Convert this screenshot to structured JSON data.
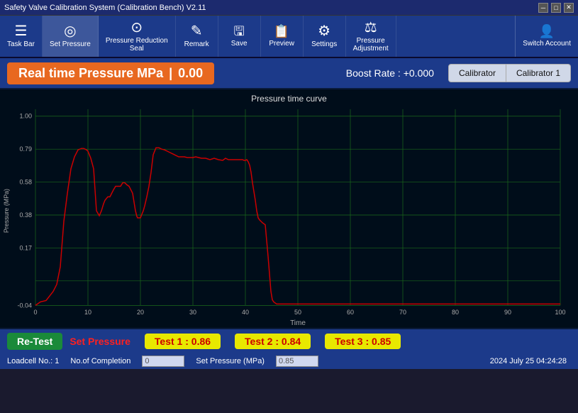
{
  "window": {
    "title": "Safety Valve Calibration System (Calibration Bench) V2.11",
    "minimize": "─",
    "maximize": "□",
    "close": "✕"
  },
  "toolbar": {
    "items": [
      {
        "id": "task-bar",
        "icon": "☰",
        "label": "Task Bar"
      },
      {
        "id": "set-pressure",
        "icon": "◎",
        "label": "Set Pressure"
      },
      {
        "id": "pressure-reduction-seal",
        "icon": "⊙",
        "label": "Pressure Reduction\nSeal"
      },
      {
        "id": "remark",
        "icon": "✎",
        "label": "Remark"
      },
      {
        "id": "save",
        "icon": "💾",
        "label": "Save"
      },
      {
        "id": "preview",
        "icon": "📋",
        "label": "Preview"
      },
      {
        "id": "settings",
        "icon": "⚙",
        "label": "Settings"
      },
      {
        "id": "pressure-adjustment",
        "icon": "⚖",
        "label": "Pressure\nAdjustment"
      }
    ],
    "switch_account_label": "Switch Account",
    "switch_account_icon": "👤"
  },
  "pressure": {
    "label": "Real time Pressure MPa",
    "separator": "|",
    "value": "0.00",
    "boost_rate_label": "Boost Rate :",
    "boost_rate_value": "+0.000",
    "calibrator_label": "Calibrator",
    "calibrator1_label": "Calibrator 1"
  },
  "chart": {
    "title": "Pressure time curve",
    "y_axis_label": "Pressure (MPa)",
    "x_axis_label": "Time",
    "y_ticks": [
      "1.00",
      "0.79",
      "0.58",
      "0.38",
      "0.17",
      "-0.04"
    ],
    "x_ticks": [
      "0",
      "10",
      "20",
      "30",
      "40",
      "50",
      "60",
      "70",
      "80",
      "90",
      "100"
    ],
    "bg_color": "#000d1a",
    "grid_color": "#1a5a1a",
    "line_color": "#cc0000"
  },
  "bottom": {
    "retest_label": "Re-Test",
    "set_pressure_label": "Set Pressure",
    "test1_label": "Test 1 : 0.86",
    "test2_label": "Test 2 : 0.84",
    "test3_label": "Test 3 : 0.85",
    "loadcell_label": "Loadcell No.: 1",
    "completion_label": "No.of Completion",
    "completion_value": "0",
    "set_pressure_field_label": "Set Pressure (MPa)",
    "set_pressure_field_value": "0.85",
    "datetime": "2024 July 25  04:24:28"
  }
}
